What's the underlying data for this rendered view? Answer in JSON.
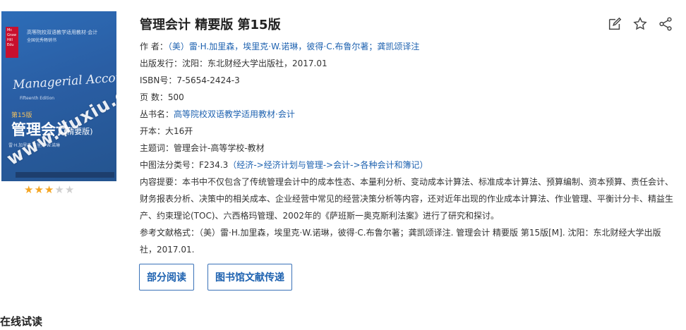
{
  "cover": {
    "series_line": "高等院校双语教学适用教材·会计",
    "series_line2": "全国优秀畅销书",
    "en_title": "Managerial Accounting",
    "en_sub": "Fifteenth Edition",
    "edition": "第15版",
    "cn_title": "管理会计",
    "cn_sub": "(精要版)",
    "authors_line": "雷·H.加里森  埃里克·W.诺琳",
    "watermark": "www.duxiu.com",
    "rating": 3,
    "rating_max": 5
  },
  "book": {
    "title": "管理会计 精要版 第15版",
    "author_label": "作 者：",
    "author_value": "（美）雷·H.加里森，埃里克·W.诺琳，彼得·C.布鲁尔著；龚凯颂译注",
    "publish_label": "出版发行：",
    "publish_value": "沈阳：东北财经大学出版社，2017.01",
    "isbn_label": "ISBN号：",
    "isbn_value": "7-5654-2424-3",
    "pages_label": "页 数：",
    "pages_value": "500",
    "series_label": "丛书名：",
    "series_value": "高等院校双语教学适用教材·会计",
    "format_label": "开本：",
    "format_value": "大16开",
    "subject_label": "主题词：",
    "subject_value": "管理会计-高等学校-教材",
    "class_label": "中图法分类号：",
    "class_code": "F234.3",
    "class_open": "（",
    "class_1": "经济",
    "class_sep1": "->",
    "class_2": "经济计划与管理",
    "class_sep2": "->",
    "class_3": "会计",
    "class_sep3": "->",
    "class_4": "各种会计和簿记",
    "class_close": "）",
    "desc_label": "内容提要：",
    "desc_value": "本书中不仅包含了传统管理会计中的成本性态、本量利分析、变动成本计算法、标准成本计算法、预算编制、资本预算、责任会计、财务报表分析、决策中的相关成本、企业经营中常见的经营决策分析等内容，还对近年出现的作业成本计算法、作业管理、平衡计分卡、精益生产、约束理论(TOC)、六西格玛管理、2002年的《萨班斯一奥克斯利法案》进行了研究和探讨。",
    "ref_label": "参考文献格式：",
    "ref_value": "（美）雷·H.加里森，埃里克·W.诺琳，彼得·C.布鲁尔著；龚凯颂译注. 管理会计 精要版 第15版[M]. 沈阳：东北财经大学出版社，2017.01."
  },
  "buttons": {
    "partial_read": "部分阅读",
    "library_delivery": "图书馆文献传递"
  },
  "icons": {
    "edit": "edit-icon",
    "favorite": "star-icon",
    "share": "share-icon"
  },
  "section": {
    "online_read": "在线试读"
  },
  "colors": {
    "link": "#1e62b0",
    "star": "#f5a623",
    "cover": "#2a5ea4"
  }
}
